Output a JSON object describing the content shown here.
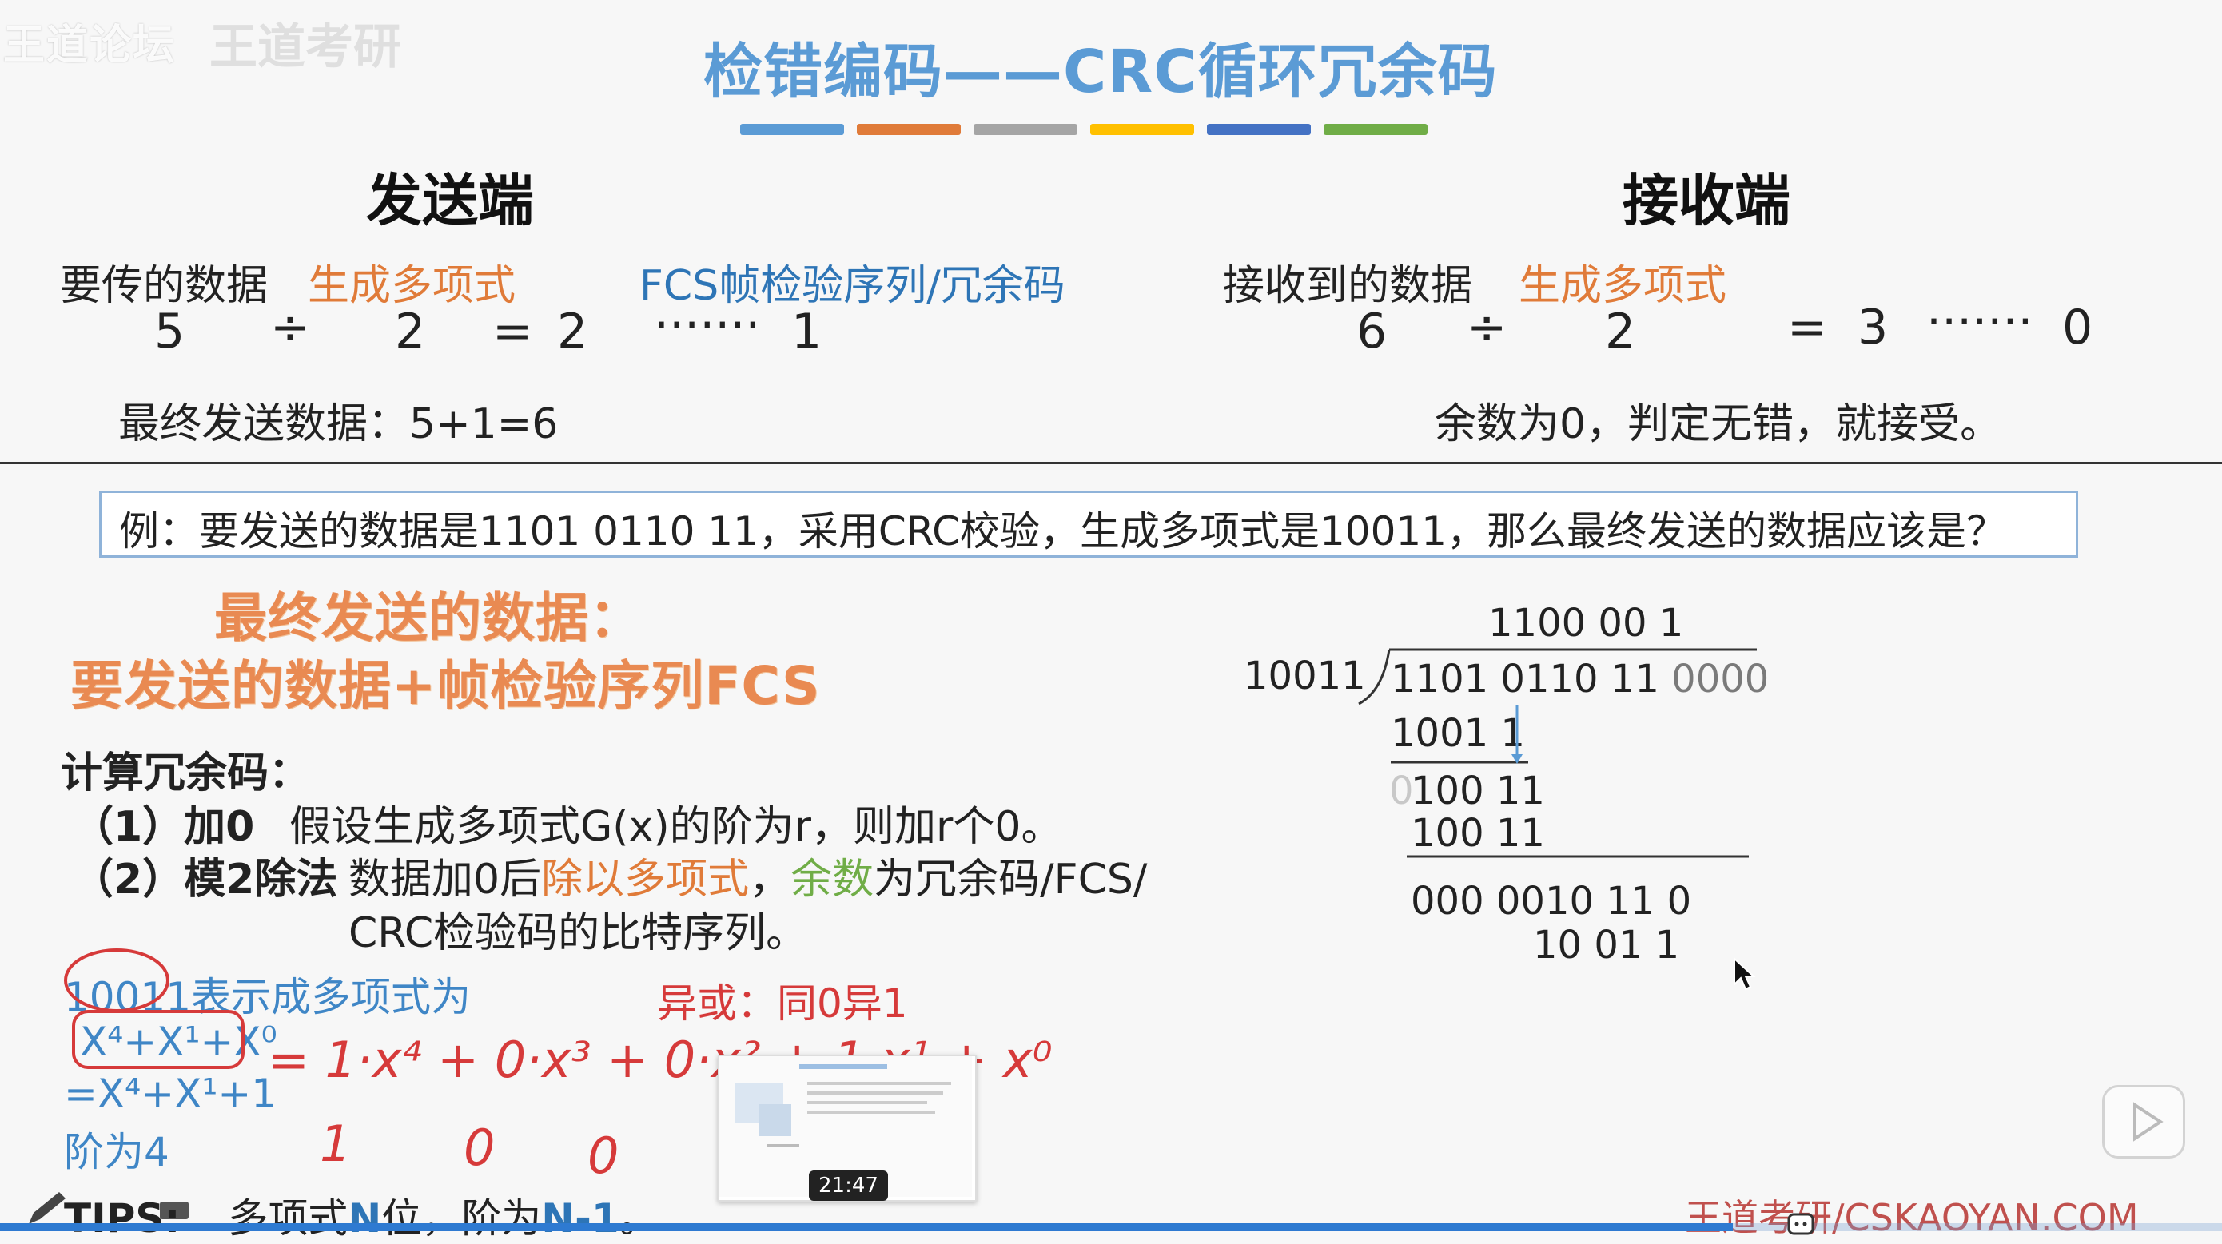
{
  "watermark": {
    "forum": "王道论坛",
    "faint": "王道考研"
  },
  "title": "检错编码——CRC循环冗余码",
  "stripe_colors": [
    "#5b9bd5",
    "#e07b39",
    "#a5a5a5",
    "#ffc000",
    "#4472c4",
    "#70ad47"
  ],
  "sender": {
    "heading": "发送端",
    "data_label": "要传的数据",
    "poly_label": "生成多项式",
    "fcs_label": "FCS帧检验序列/冗余码",
    "dividend": "5",
    "div_sign": "÷",
    "divisor": "2",
    "eq": "=",
    "quotient": "2",
    "dots": "·······",
    "remainder": "1",
    "final_line": "最终发送数据：5+1=6"
  },
  "receiver": {
    "heading": "接收端",
    "data_label": "接收到的数据",
    "poly_label": "生成多项式",
    "dividend": "6",
    "div_sign": "÷",
    "divisor": "2",
    "eq": "=",
    "quotient": "3",
    "dots": "·······",
    "remainder": "0",
    "final_line": "余数为0，判定无错，就接受。"
  },
  "example": "例：要发送的数据是1101 0110 11，采用CRC校验，生成多项式是10011，那么最终发送的数据应该是？",
  "final_data": {
    "line1": "最终发送的数据：",
    "line2": "要发送的数据+帧检验序列FCS"
  },
  "calc": {
    "heading": "计算冗余码：",
    "step1_num": "（1）加0",
    "step1_text": "假设生成多项式G(x)的阶为r，则加r个0。",
    "step2_num": "（2）模2除法",
    "step2_a": "数据加0后",
    "step2_b": "除以多项式",
    "step2_c": "，",
    "step2_d": "余数",
    "step2_e": "为冗余码/FCS/",
    "step2_f": "CRC检验码的比特序列。"
  },
  "handwritten": {
    "poly_desc": "10011表示成多项式为",
    "poly_terms": "X⁴+X¹+X⁰",
    "poly_simplified": "=X⁴+X¹+1",
    "order": "阶为4",
    "xor_rule": "异或：同0异1",
    "expansion": "= 1·x⁴ + 0·x³ + 0·x² + 1·x¹ + x⁰",
    "coef1": "1",
    "coef2": "0",
    "coef3": "0"
  },
  "division": {
    "quotient": "1100 00 1",
    "divisor": "10011",
    "dividend": "1101 0110 11",
    "padding": "0000",
    "step1": "1001 1",
    "partial": "100 11",
    "partial_lead": "0",
    "step2": "100 11",
    "result": "000 0010 11  0",
    "step3": "10 01 1"
  },
  "tips": {
    "prefix": "TIPS:",
    "a": "多项式",
    "b": "N",
    "c": "位，阶为",
    "d": "N-1",
    "e": "。"
  },
  "footer_brand": "王道考研/CSKAOYAN.COM",
  "video": {
    "thumb_time": "21:47",
    "progress": 0.78
  }
}
